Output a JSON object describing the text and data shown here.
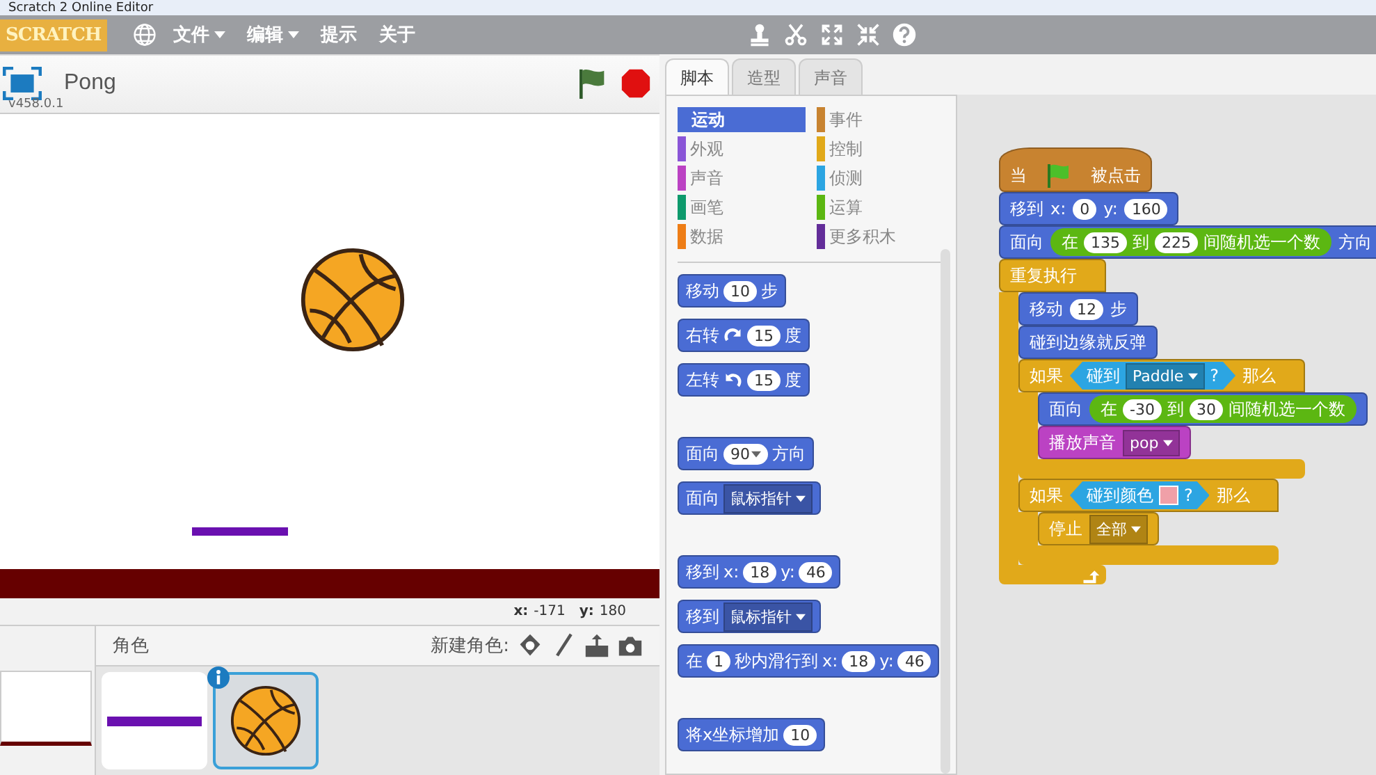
{
  "window": {
    "title": "Scratch 2 Online Editor"
  },
  "menubar": {
    "logo": "SCRATCH",
    "menus": [
      {
        "label": "文件",
        "dropdown": true
      },
      {
        "label": "编辑",
        "dropdown": true
      },
      {
        "label": "提示",
        "dropdown": false
      },
      {
        "label": "关于",
        "dropdown": false
      }
    ]
  },
  "stage": {
    "project_title": "Pong",
    "version": "v458.0.1",
    "coords": [
      {
        "label": "x:",
        "value": "-171"
      },
      {
        "label": "y:",
        "value": "180"
      }
    ]
  },
  "sprites": {
    "title": "角色",
    "new_sprite_label": "新建角色:",
    "items": [
      {
        "kind": "paddle",
        "selected": false
      },
      {
        "kind": "ball",
        "selected": true
      }
    ]
  },
  "tabs": [
    {
      "label": "脚本",
      "selected": true
    },
    {
      "label": "造型",
      "selected": false
    },
    {
      "label": "声音",
      "selected": false
    }
  ],
  "categories": [
    {
      "label": "运动",
      "color": "#4a6cd4",
      "selected": true
    },
    {
      "label": "外观",
      "color": "#8a55d7",
      "selected": false
    },
    {
      "label": "声音",
      "color": "#bb42c3",
      "selected": false
    },
    {
      "label": "画笔",
      "color": "#0e9a6c",
      "selected": false
    },
    {
      "label": "数据",
      "color": "#ee7d16",
      "selected": false
    },
    {
      "label": "事件",
      "color": "#c88330",
      "selected": false
    },
    {
      "label": "控制",
      "color": "#e1a91a",
      "selected": false
    },
    {
      "label": "侦测",
      "color": "#2ca5e2",
      "selected": false
    },
    {
      "label": "运算",
      "color": "#5cb712",
      "selected": false
    },
    {
      "label": "更多积木",
      "color": "#632d99",
      "selected": false
    }
  ],
  "palette": [
    [
      {
        "kind": "stack",
        "color": "#4a6cd4",
        "parts": [
          {
            "kind": "text",
            "text": "移动"
          },
          {
            "kind": "num",
            "text": "10"
          },
          {
            "kind": "text",
            "text": "步"
          }
        ]
      },
      {
        "kind": "stack",
        "color": "#4a6cd4",
        "parts": [
          {
            "kind": "text",
            "text": "右转"
          },
          {
            "kind": "cw-arrow"
          },
          {
            "kind": "num",
            "text": "15"
          },
          {
            "kind": "text",
            "text": "度"
          }
        ]
      },
      {
        "kind": "stack",
        "color": "#4a6cd4",
        "parts": [
          {
            "kind": "text",
            "text": "左转"
          },
          {
            "kind": "ccw-arrow"
          },
          {
            "kind": "num",
            "text": "15"
          },
          {
            "kind": "text",
            "text": "度"
          }
        ]
      }
    ],
    [
      {
        "kind": "stack",
        "color": "#4a6cd4",
        "parts": [
          {
            "kind": "text",
            "text": "面向"
          },
          {
            "kind": "num-menu",
            "text": "90"
          },
          {
            "kind": "text",
            "text": "方向"
          }
        ]
      },
      {
        "kind": "stack",
        "color": "#4a6cd4",
        "parts": [
          {
            "kind": "text",
            "text": "面向"
          },
          {
            "kind": "menu",
            "text": "鼠标指针"
          }
        ]
      }
    ],
    [
      {
        "kind": "stack",
        "color": "#4a6cd4",
        "parts": [
          {
            "kind": "text",
            "text": "移到"
          },
          {
            "kind": "text",
            "text": "x:"
          },
          {
            "kind": "num",
            "text": "18"
          },
          {
            "kind": "text",
            "text": "y:"
          },
          {
            "kind": "num",
            "text": "46"
          }
        ]
      },
      {
        "kind": "stack",
        "color": "#4a6cd4",
        "parts": [
          {
            "kind": "text",
            "text": "移到"
          },
          {
            "kind": "menu",
            "text": "鼠标指针"
          }
        ]
      },
      {
        "kind": "stack",
        "color": "#4a6cd4",
        "parts": [
          {
            "kind": "text",
            "text": "在"
          },
          {
            "kind": "num",
            "text": "1"
          },
          {
            "kind": "text",
            "text": "秒内滑行到"
          },
          {
            "kind": "text",
            "text": "x:"
          },
          {
            "kind": "num",
            "text": "18"
          },
          {
            "kind": "text",
            "text": "y:"
          },
          {
            "kind": "num",
            "text": "46"
          }
        ]
      }
    ],
    [
      {
        "kind": "stack",
        "color": "#4a6cd4",
        "parts": [
          {
            "kind": "text",
            "text": "将x坐标增加"
          },
          {
            "kind": "num",
            "text": "10"
          }
        ]
      }
    ]
  ],
  "scripts": [
    [
      {
        "kind": "hat",
        "color": "#c88330",
        "parts": [
          {
            "kind": "text",
            "text": "当"
          },
          {
            "kind": "flag"
          },
          {
            "kind": "text",
            "text": "被点击"
          }
        ]
      },
      {
        "kind": "stack",
        "color": "#4a6cd4",
        "parts": [
          {
            "kind": "text",
            "text": "移到"
          },
          {
            "kind": "text",
            "text": "x:"
          },
          {
            "kind": "num",
            "text": "0"
          },
          {
            "kind": "text",
            "text": "y:"
          },
          {
            "kind": "num",
            "text": "160"
          }
        ]
      },
      {
        "kind": "stack",
        "color": "#4a6cd4",
        "parts": [
          {
            "kind": "text",
            "text": "面向"
          },
          {
            "kind": "reporter",
            "color": "#5cb712",
            "parts": [
              {
                "kind": "text",
                "text": "在"
              },
              {
                "kind": "num",
                "text": "135"
              },
              {
                "kind": "text",
                "text": "到"
              },
              {
                "kind": "num",
                "text": "225"
              },
              {
                "kind": "text",
                "text": "间随机选一个数"
              }
            ]
          },
          {
            "kind": "text",
            "text": "方向"
          }
        ]
      },
      {
        "kind": "forever",
        "color": "#e1a91a",
        "parts": [
          {
            "kind": "text",
            "text": "重复执行"
          }
        ],
        "children": [
          {
            "kind": "stack",
            "color": "#4a6cd4",
            "parts": [
              {
                "kind": "text",
                "text": "移动"
              },
              {
                "kind": "num",
                "text": "12"
              },
              {
                "kind": "text",
                "text": "步"
              }
            ]
          },
          {
            "kind": "stack",
            "color": "#4a6cd4",
            "parts": [
              {
                "kind": "text",
                "text": "碰到边缘就反弹"
              }
            ]
          },
          {
            "kind": "if",
            "color": "#e1a91a",
            "parts": [
              {
                "kind": "text",
                "text": "如果"
              },
              {
                "kind": "boolean",
                "color": "#2ca5e2",
                "parts": [
                  {
                    "kind": "text",
                    "text": "碰到"
                  },
                  {
                    "kind": "menu",
                    "text": "Paddle"
                  },
                  {
                    "kind": "text",
                    "text": "?"
                  }
                ]
              },
              {
                "kind": "text",
                "text": "那么"
              }
            ],
            "children": [
              {
                "kind": "stack",
                "color": "#4a6cd4",
                "parts": [
                  {
                    "kind": "text",
                    "text": "面向"
                  },
                  {
                    "kind": "reporter",
                    "color": "#5cb712",
                    "parts": [
                      {
                        "kind": "text",
                        "text": "在"
                      },
                      {
                        "kind": "num",
                        "text": "-30"
                      },
                      {
                        "kind": "text",
                        "text": "到"
                      },
                      {
                        "kind": "num",
                        "text": "30"
                      },
                      {
                        "kind": "text",
                        "text": "间随机选一个数"
                      }
                    ]
                  }
                ]
              },
              {
                "kind": "stack",
                "color": "#bb42c3",
                "parts": [
                  {
                    "kind": "text",
                    "text": "播放声音"
                  },
                  {
                    "kind": "menu",
                    "text": "pop"
                  }
                ]
              }
            ]
          },
          {
            "kind": "if",
            "color": "#e1a91a",
            "parts": [
              {
                "kind": "text",
                "text": "如果"
              },
              {
                "kind": "boolean",
                "color": "#2ca5e2",
                "parts": [
                  {
                    "kind": "text",
                    "text": "碰到颜色"
                  },
                  {
                    "kind": "swatch",
                    "color": "#f0a0a8"
                  },
                  {
                    "kind": "text",
                    "text": "?"
                  }
                ]
              },
              {
                "kind": "text",
                "text": "那么"
              }
            ],
            "children": [
              {
                "kind": "stack",
                "parts": [
                  {
                    "kind": "text",
                    "text": "停止"
                  },
                  {
                    "kind": "menu",
                    "text": "全部"
                  }
                ]
              }
            ]
          }
        ]
      }
    ]
  ]
}
